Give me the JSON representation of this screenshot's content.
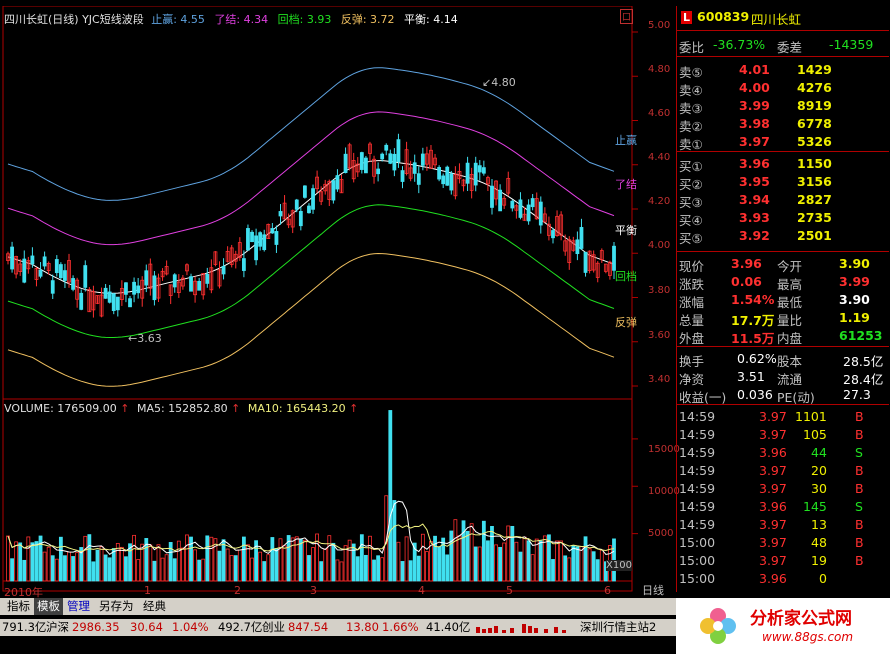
{
  "stock": {
    "code": "600839",
    "name": "四川长虹",
    "badge": "L"
  },
  "indicator": {
    "title": "四川长虹(日线) YJC短线波段",
    "items": [
      {
        "label": "止赢: 4.55",
        "color": "#5fa3e0"
      },
      {
        "label": "了结: 4.34",
        "color": "#e040e0"
      },
      {
        "label": "回档: 3.93",
        "color": "#20e020"
      },
      {
        "label": "反弹: 3.72",
        "color": "#f0c060"
      },
      {
        "label": "平衡: 4.14",
        "color": "#ffffff"
      }
    ],
    "line_tags": [
      "止赢",
      "了结",
      "平衡",
      "回档",
      "反弹"
    ],
    "high_label": "4.80",
    "low_label": "3.63",
    "yticks": [
      "5.00",
      "4.80",
      "4.60",
      "4.40",
      "4.20",
      "4.00",
      "3.80",
      "3.60",
      "3.40"
    ]
  },
  "volume": {
    "vol": "VOLUME: 176509.00",
    "ma5": "MA5: 152852.80",
    "ma10": "MA10: 165443.20",
    "yticks": [
      "15000",
      "10000",
      "5000"
    ],
    "unit": "X100"
  },
  "xaxis": {
    "labels": [
      "2010年",
      "1",
      "2",
      "3",
      "4",
      "5",
      "6"
    ],
    "period": "日线"
  },
  "panel": {
    "weibi": {
      "l1": "委比",
      "v1": "-36.73%",
      "l2": "委差",
      "v2": "-14359"
    },
    "sells": [
      {
        "label": "卖⑤",
        "price": "4.01",
        "vol": "1429"
      },
      {
        "label": "卖④",
        "price": "4.00",
        "vol": "4276"
      },
      {
        "label": "卖③",
        "price": "3.99",
        "vol": "8919"
      },
      {
        "label": "卖②",
        "price": "3.98",
        "vol": "6778"
      },
      {
        "label": "卖①",
        "price": "3.97",
        "vol": "5326"
      }
    ],
    "buys": [
      {
        "label": "买①",
        "price": "3.96",
        "vol": "1150"
      },
      {
        "label": "买②",
        "price": "3.95",
        "vol": "3156"
      },
      {
        "label": "买③",
        "price": "3.94",
        "vol": "2827"
      },
      {
        "label": "买④",
        "price": "3.93",
        "vol": "2735"
      },
      {
        "label": "买⑤",
        "price": "3.92",
        "vol": "2501"
      }
    ],
    "quote": [
      {
        "l1": "现价",
        "v1": "3.96",
        "l2": "今开",
        "v2": "3.90"
      },
      {
        "l1": "涨跌",
        "v1": "0.06",
        "l2": "最高",
        "v2": "3.99"
      },
      {
        "l1": "涨幅",
        "v1": "1.54%",
        "l2": "最低",
        "v2": "3.90"
      },
      {
        "l1": "总量",
        "v1": "17.7万",
        "l2": "量比",
        "v2": "1.19"
      },
      {
        "l1": "外盘",
        "v1": "11.5万",
        "l2": "内盘",
        "v2": "61253"
      }
    ],
    "fund": [
      {
        "l1": "换手",
        "v1": "0.62%",
        "l2": "股本",
        "v2": "28.5亿"
      },
      {
        "l1": "净资",
        "v1": "3.51",
        "l2": "流通",
        "v2": "28.4亿"
      },
      {
        "l1": "收益(一)",
        "v1": "0.036",
        "l2": "PE(动)",
        "v2": "27.3"
      }
    ],
    "ticks": [
      {
        "t": "14:59",
        "p": "3.97",
        "v": "1101",
        "s": "B"
      },
      {
        "t": "14:59",
        "p": "3.97",
        "v": "105",
        "s": "B"
      },
      {
        "t": "14:59",
        "p": "3.96",
        "v": "44",
        "s": "S"
      },
      {
        "t": "14:59",
        "p": "3.97",
        "v": "20",
        "s": "B"
      },
      {
        "t": "14:59",
        "p": "3.97",
        "v": "30",
        "s": "B"
      },
      {
        "t": "14:59",
        "p": "3.96",
        "v": "145",
        "s": "S"
      },
      {
        "t": "14:59",
        "p": "3.97",
        "v": "13",
        "s": "B"
      },
      {
        "t": "15:00",
        "p": "3.97",
        "v": "48",
        "s": "B"
      },
      {
        "t": "15:00",
        "p": "3.97",
        "v": "19",
        "s": "B"
      },
      {
        "t": "15:00",
        "p": "3.96",
        "v": "0",
        "s": ""
      }
    ]
  },
  "tabs": [
    "指标",
    "模板",
    "管理",
    "另存为",
    "经典"
  ],
  "statusbar": {
    "s1": "791.3亿",
    "s2": "沪深",
    "s3": "2986.35",
    "s4": "30.64",
    "s5": "1.04%",
    "s6": "492.7亿",
    "s7": "创业",
    "s8": "847.54",
    "s9": "13.80",
    "s10": "1.66%",
    "s11": "41.40亿",
    "s12": "深圳行情主站2"
  },
  "watermark": {
    "text": "分析家公式网",
    "url": "www.88gs.com"
  }
}
